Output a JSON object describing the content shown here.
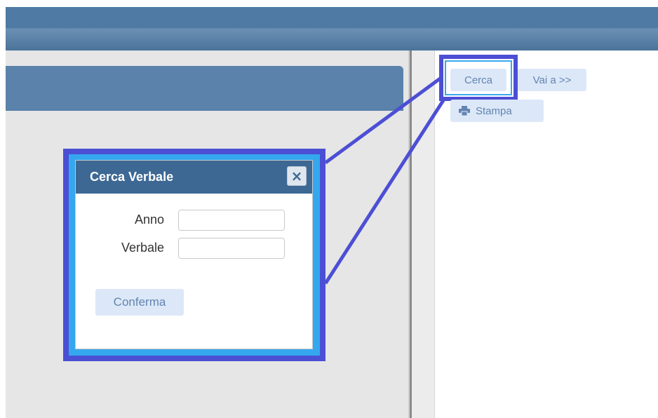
{
  "toolbar": {
    "cerca_label": "Cerca",
    "vai_label": "Vai a >>",
    "stampa_label": "Stampa",
    "print_icon": "printer-icon"
  },
  "dialog": {
    "title": "Cerca Verbale",
    "close_label": "×",
    "fields": [
      {
        "label": "Anno",
        "value": ""
      },
      {
        "label": "Verbale",
        "value": ""
      }
    ],
    "confirm_label": "Conferma"
  },
  "colors": {
    "header_blue": "#4f7aa3",
    "dialog_title_blue": "#3d6894",
    "button_bg": "#dce8f8",
    "button_text": "#6384b0",
    "highlight_border": "#4c4fd4",
    "highlight_inner": "#38a9ee"
  }
}
